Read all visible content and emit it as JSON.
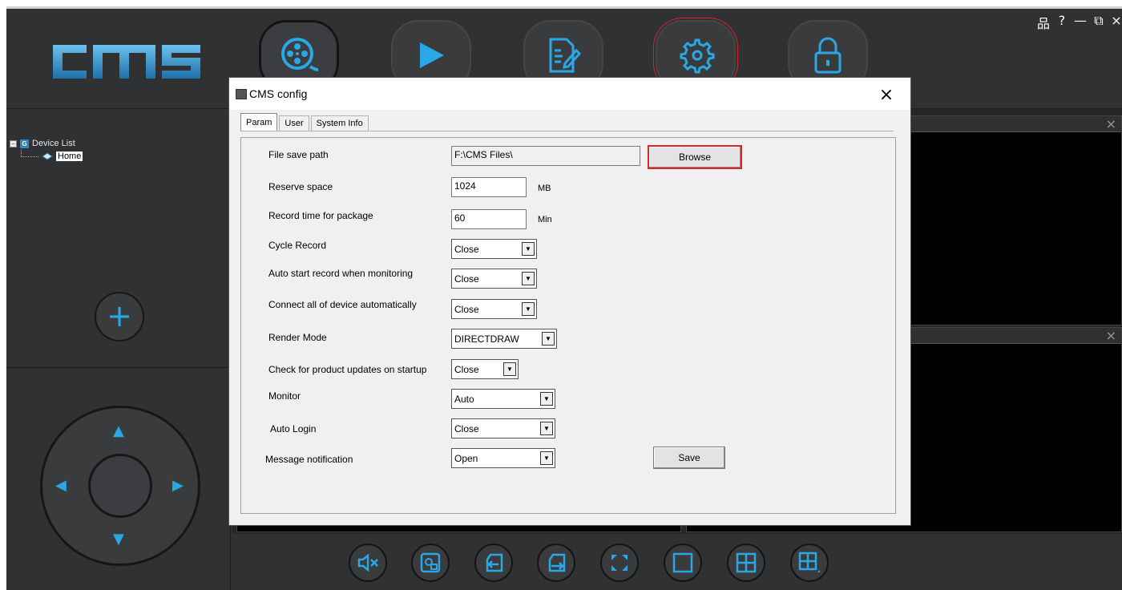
{
  "app": {
    "logo_text": "CMS",
    "window_controls": {
      "network": "品",
      "help": "?",
      "minimize": "—",
      "restore": "⧉",
      "close": "×"
    }
  },
  "nav": {
    "items": [
      {
        "name": "monitor",
        "icon": "film-reel-icon",
        "active": true
      },
      {
        "name": "playback",
        "icon": "play-icon"
      },
      {
        "name": "log",
        "icon": "edit-document-icon"
      },
      {
        "name": "settings",
        "icon": "gear-icon",
        "highlighted": true
      },
      {
        "name": "lock",
        "icon": "lock-icon"
      }
    ]
  },
  "device_tree": {
    "root_label": "Device List",
    "root_toggle": "−",
    "root_badge": "G",
    "children": [
      {
        "label": "Home"
      }
    ]
  },
  "ptz": {
    "up": "▲",
    "down": "▼",
    "left": "◀",
    "right": "▶"
  },
  "add_device_label": "+",
  "video_panels": {
    "close": "×"
  },
  "dialog": {
    "title": "CMS config",
    "close": "×",
    "tabs": [
      {
        "label": "Param",
        "active": true
      },
      {
        "label": "User"
      },
      {
        "label": "System Info"
      }
    ],
    "fields": {
      "file_save_path": {
        "label": "File save path",
        "value": "F:\\CMS Files\\"
      },
      "browse_label": "Browse",
      "reserve_space": {
        "label": "Reserve space",
        "value": "1024",
        "unit": "MB"
      },
      "record_time": {
        "label": "Record time for package",
        "value": "60",
        "unit": "Min"
      },
      "cycle_record": {
        "label": "Cycle Record",
        "value": "Close"
      },
      "auto_start": {
        "label": "Auto start record when monitoring",
        "value": "Close"
      },
      "connect_all": {
        "label": "Connect all of device automatically",
        "value": "Close"
      },
      "render_mode": {
        "label": "Render Mode",
        "value": "DIRECTDRAW"
      },
      "check_updates": {
        "label": "Check for product updates on startup",
        "value": "Close"
      },
      "monitor": {
        "label": "Monitor",
        "value": "Auto"
      },
      "auto_login": {
        "label": "Auto Login",
        "value": "Close"
      },
      "message_notification": {
        "label": "Message notification",
        "value": "Open"
      },
      "save_label": "Save"
    }
  },
  "bottom_toolbar": [
    "mute-icon",
    "capture-icon",
    "import-icon",
    "export-icon",
    "fullscreen-icon",
    "single-view-icon",
    "quad-view-icon",
    "multi-view-icon"
  ],
  "colors": {
    "accent": "#2aa8e6",
    "background": "#2f3032",
    "highlight": "#e0222a"
  }
}
